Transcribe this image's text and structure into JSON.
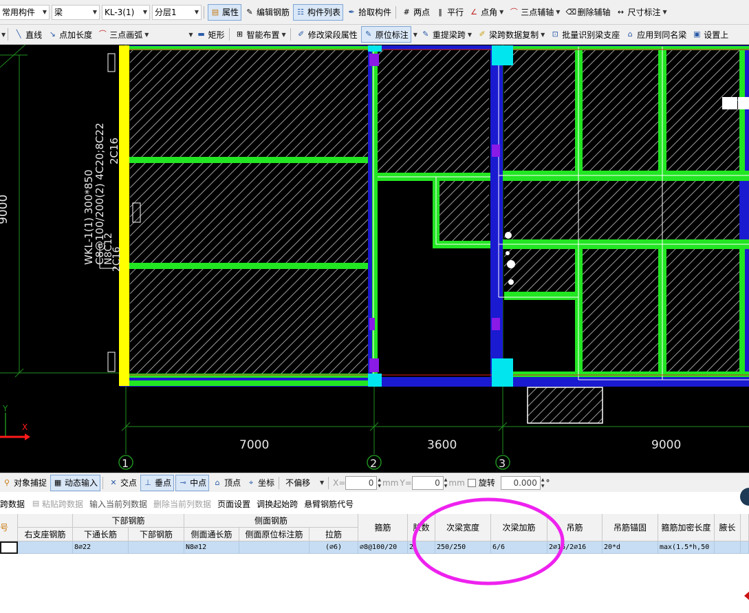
{
  "toolbar1": {
    "combo_component_group": "常用构件",
    "combo_type": "梁",
    "combo_name": "KL-3(1)",
    "combo_layer": "分层1",
    "btn_properties": "属性",
    "btn_edit_rebar": "编辑钢筋",
    "btn_component_list": "构件列表",
    "btn_pick": "拾取构件",
    "btn_two_points": "两点",
    "btn_parallel": "平行",
    "btn_point_angle": "点角",
    "btn_three_point_axis": "三点辅轴",
    "btn_delete_axis": "删除辅轴",
    "btn_dimension": "尺寸标注"
  },
  "toolbar2": {
    "btn_line": "直线",
    "btn_point_length": "点加长度",
    "btn_arc": "三点画弧",
    "btn_rect": "矩形",
    "btn_smart_layout": "智能布置",
    "btn_modify_segment": "修改梁段属性",
    "btn_in_situ": "原位标注",
    "btn_reextract": "重提梁跨",
    "btn_copy_span": "梁跨数据复制",
    "btn_batch_identify": "批量识别梁支座",
    "btn_apply_same": "应用到同名梁",
    "btn_set_top": "设置上"
  },
  "drawing": {
    "beam_label_line1": "2C16",
    "beam_label_line2": "WKL-1(1) 300*850",
    "beam_label_line3": "C8@100/200(2) 4C20;8C22",
    "beam_label_line4": "N8C12",
    "beam_label_line5": "2C16",
    "left_dim": "9000",
    "dim_span1": "7000",
    "dim_span2": "3600",
    "dim_span3": "9000",
    "axis_1": "1",
    "axis_2": "2",
    "axis_3": "3",
    "ucs_y": "Y",
    "ucs_x": "X",
    "colors": {
      "background": "#000000",
      "beam_green": "#22e622",
      "wall_yellow": "#ffff00",
      "column_cyan": "#00e5ee",
      "beam_blue": "#1a1ad0",
      "column_purple": "#8a1ae6",
      "grid_green": "#1f8f1f"
    }
  },
  "status_bar": {
    "snap": "对象捕捉",
    "dynamic_input": "动态输入",
    "intersection": "交点",
    "perpendicular": "垂点",
    "midpoint": "中点",
    "vertex": "顶点",
    "coordinate": "坐标",
    "offset_mode": "不偏移",
    "x_label": "X=",
    "x_value": "0",
    "x_unit": "mm",
    "y_label": "Y=",
    "y_value": "0",
    "y_unit": "mm",
    "rotate_label": "旋转",
    "rotate_value": "0.000",
    "degree": "°"
  },
  "table_toolbar": {
    "copy_span": "跨数据",
    "paste_span": "粘贴跨数据",
    "input_column": "输入当前列数据",
    "delete_column": "删除当前列数据",
    "page_setup": "页面设置",
    "swap_start": "调换起始跨",
    "cantilever_code": "悬臂钢筋代号"
  },
  "table": {
    "group_headers": {
      "span_no": "跨号",
      "bottom_rebar": "下部钢筋",
      "side_rebar": "侧面钢筋"
    },
    "headers": {
      "right_support": "右支座钢筋",
      "bottom_through": "下通长筋",
      "bottom": "下部钢筋",
      "side_through": "侧面通长筋",
      "side_in_situ": "侧面原位标注筋",
      "tie": "拉筋",
      "stirrup": "箍筋",
      "legs": "肢数",
      "secondary_width": "次梁宽度",
      "secondary_add": "次梁加筋",
      "hanger": "吊筋",
      "hanger_anchor": "吊筋锚固",
      "dense_length": "箍筋加密长度",
      "haunch": "腋长"
    },
    "row": {
      "right_support": "",
      "bottom_through": "8⌀22",
      "bottom": "",
      "side_through": "N8⌀12",
      "side_in_situ": "",
      "tie": "(⌀6)",
      "stirrup": "⌀8@100/20",
      "legs": "2",
      "secondary_width": "250/250",
      "secondary_add": "6/6",
      "hanger": "2⌀16/2⌀16",
      "hanger_anchor": "20*d",
      "dense_length": "max(1.5*h,50",
      "haunch": ""
    }
  },
  "annotation": {
    "ellipse_color": "#ee22ee"
  }
}
